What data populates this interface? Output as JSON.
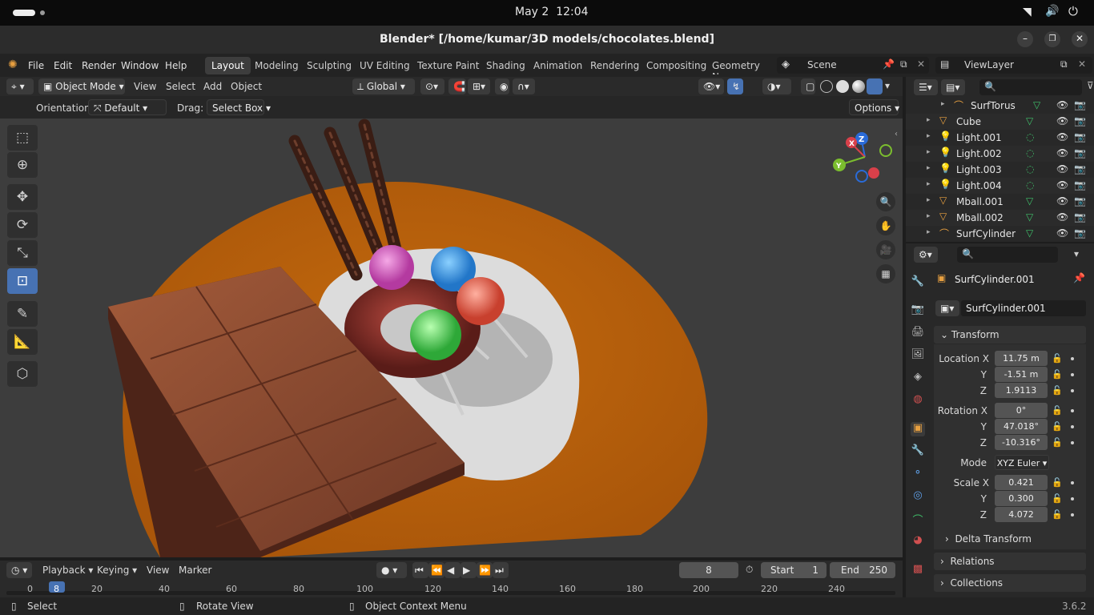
{
  "os": {
    "date": "May 2",
    "time": "12:04"
  },
  "window": {
    "title": "Blender* [/home/kumar/3D models/chocolates.blend]"
  },
  "menu": {
    "items": [
      "File",
      "Edit",
      "Render",
      "Window",
      "Help"
    ]
  },
  "workspaces": [
    "Layout",
    "Modeling",
    "Sculpting",
    "UV Editing",
    "Texture Paint",
    "Shading",
    "Animation",
    "Rendering",
    "Compositing",
    "Geometry Noc"
  ],
  "scene": {
    "name": "Scene",
    "view_layer": "ViewLayer"
  },
  "viewport_header": {
    "mode": "Object Mode",
    "menus": [
      "View",
      "Select",
      "Add",
      "Object"
    ],
    "transform_orientation": "Global"
  },
  "tool_settings": {
    "orientation_label": "Orientation:",
    "orientation_value": "Default",
    "drag_label": "Drag:",
    "drag_value": "Select Box",
    "options": "Options"
  },
  "gizmo": {
    "x": "X",
    "y": "Y",
    "z": "Z"
  },
  "outliner": {
    "items": [
      {
        "name": "SurfTorus",
        "icon": "surface-icon"
      },
      {
        "name": "Cube",
        "icon": "mesh-icon"
      },
      {
        "name": "Light.001",
        "icon": "light-icon"
      },
      {
        "name": "Light.002",
        "icon": "light-icon"
      },
      {
        "name": "Light.003",
        "icon": "light-icon"
      },
      {
        "name": "Light.004",
        "icon": "light-icon"
      },
      {
        "name": "Mball.001",
        "icon": "mesh-icon"
      },
      {
        "name": "Mball.002",
        "icon": "mesh-icon"
      },
      {
        "name": "SurfCylinder",
        "icon": "surface-icon"
      }
    ]
  },
  "properties": {
    "object_name": "SurfCylinder.001",
    "datablock_name": "SurfCylinder.001",
    "transform_title": "Transform",
    "location_label": "Location X",
    "location": [
      "11.75 m",
      "-1.51 m",
      "1.9113"
    ],
    "rotation_label": "Rotation X",
    "rotation": [
      "0°",
      "47.018°",
      "-10.316°"
    ],
    "mode_label": "Mode",
    "mode": "XYZ Euler",
    "scale_label": "Scale X",
    "scale": [
      "0.421",
      "0.300",
      "4.072"
    ],
    "axis_y": "Y",
    "axis_z": "Z",
    "delta": "Delta Transform",
    "relations": "Relations",
    "collections": "Collections"
  },
  "timeline": {
    "menus": [
      "Playback",
      "Keying",
      "View",
      "Marker"
    ],
    "current_frame": "8",
    "start_label": "Start",
    "start": "1",
    "end_label": "End",
    "end": "250",
    "ticks": [
      "0",
      "20",
      "40",
      "60",
      "80",
      "100",
      "120",
      "140",
      "160",
      "180",
      "200",
      "220",
      "240"
    ]
  },
  "statusbar": {
    "select": "Select",
    "rotate": "Rotate View",
    "context": "Object Context Menu",
    "version": "3.6.2"
  }
}
